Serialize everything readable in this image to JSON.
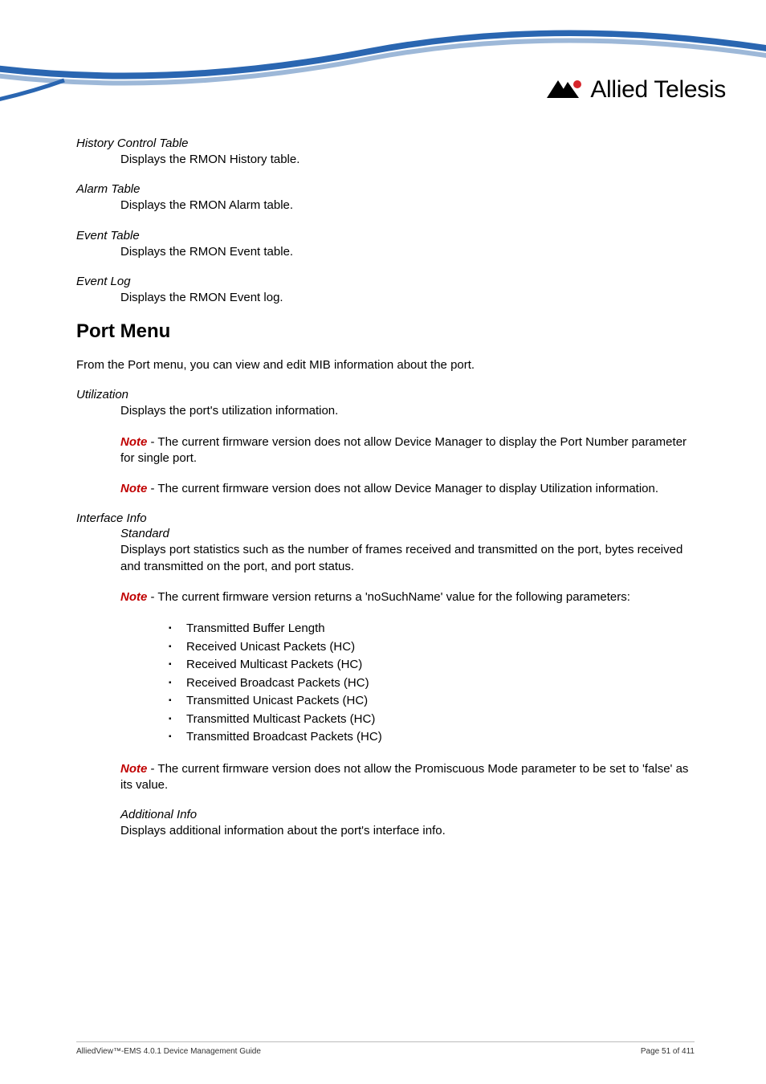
{
  "brand": {
    "name": "Allied Telesis"
  },
  "sections": {
    "history_control_table": {
      "title": "History Control Table",
      "def": "Displays the RMON History table."
    },
    "alarm_table": {
      "title": "Alarm Table",
      "def": "Displays the RMON Alarm table."
    },
    "event_table": {
      "title": "Event Table",
      "def": "Displays the RMON Event table."
    },
    "event_log": {
      "title": "Event Log",
      "def": "Displays the RMON Event log."
    },
    "port_menu": {
      "heading": "Port Menu",
      "intro": "From the Port menu, you can view and edit MIB information about the port.",
      "utilization": {
        "title": "Utilization",
        "def": "Displays the port's utilization information.",
        "note1": " - The current firmware version does not allow Device Manager to display the Port Number parameter for single port.",
        "note2": " - The current firmware version does not allow Device Manager to display Utilization information."
      },
      "interface_info": {
        "title": "Interface Info",
        "standard": {
          "title": "Standard",
          "def": "Displays port statistics such as the number of frames received and transmitted on the port, bytes received and transmitted on the port, and port status.",
          "note1": " - The current firmware version returns a 'noSuchName' value for the following parameters:",
          "bullets": [
            "Transmitted Buffer Length",
            "Received Unicast Packets (HC)",
            "Received Multicast Packets (HC)",
            "Received Broadcast Packets (HC)",
            "Transmitted Unicast Packets (HC)",
            "Transmitted Multicast Packets (HC)",
            "Transmitted Broadcast Packets (HC)"
          ],
          "note2": " - The current firmware version does not allow the Promiscuous Mode parameter to be set to 'false' as its value."
        },
        "additional_info": {
          "title": "Additional Info",
          "def": "Displays additional information about the port's interface info."
        }
      }
    }
  },
  "note_word": "Note",
  "footer": {
    "left": "AlliedView™-EMS 4.0.1 Device Management Guide",
    "right": "Page 51 of 411"
  }
}
